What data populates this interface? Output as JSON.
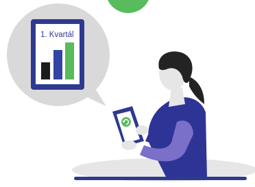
{
  "illustration": {
    "report_card": {
      "title": "1. Kvartál",
      "bars": [
        {
          "level": 0.48,
          "color": "#1c1c1c"
        },
        {
          "level": 0.78,
          "color": "#3344a4"
        },
        {
          "level": 1.0,
          "color": "#58bb5c"
        }
      ]
    },
    "colors": {
      "accent_green": "#58bb5c",
      "tablet_navy": "#2e3a8f",
      "bubble_gray": "#d9d9d9",
      "floor_gray": "#e6e6e6",
      "floor_line": "#2e3a8f",
      "skin": "#e6e6e6",
      "hair": "#232323",
      "shirt_dark": "#2e3496",
      "shirt_light": "#7a6fc9"
    },
    "icons": [
      "refresh-icon"
    ]
  }
}
